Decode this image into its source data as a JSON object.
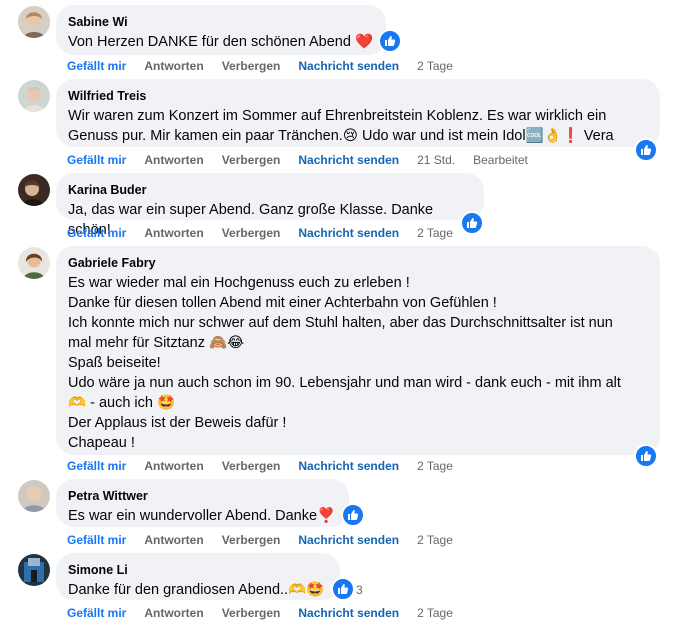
{
  "actions": {
    "like": "Gefällt mir",
    "reply": "Antworten",
    "hide": "Verbergen",
    "message": "Nachricht senden"
  },
  "colors": {
    "link": "#1877f2",
    "bubble": "#f0f2f5",
    "meta": "#65676b"
  },
  "comments": [
    {
      "author": "Sabine Wi",
      "text": "Von Herzen DANKE für den schönen Abend ❤️",
      "time": "2 Tage",
      "avatar_icon": "profile-photo",
      "reaction_icon": "like-reaction-icon"
    },
    {
      "author": "Wilfried Treis",
      "text": "Wir waren zum Konzert im Sommer auf Ehrenbreitstein Koblenz. Es war wirklich ein\nGenuss pur. Mir kamen ein paar Tränchen.😢 Udo war und ist mein Idol🆒👌❗ Vera",
      "time": "21 Std.",
      "edited": "Bearbeitet",
      "avatar_icon": "profile-photo",
      "reaction_icon": "like-reaction-icon"
    },
    {
      "author": "Karina Buder",
      "text": "Ja, das war ein super Abend. Ganz große Klasse. Danke schön!",
      "time": "2 Tage",
      "avatar_icon": "profile-photo",
      "reaction_icon": "like-reaction-icon"
    },
    {
      "author": "Gabriele Fabry",
      "text": "Es war wieder mal ein Hochgenuss euch zu erleben !\nDanke für diesen tollen Abend mit einer Achterbahn von Gefühlen !\nIch konnte mich nur schwer auf dem Stuhl halten, aber das Durchschnittsalter ist nun\nmal mehr für Sitztanz 🙈😂\nSpaß beiseite!\nUdo wäre ja nun auch schon im 90. Lebensjahr und man wird - dank euch - mit ihm alt\n🫶 - auch ich 🤩\nDer Applaus ist der Beweis dafür !\nChapeau !",
      "time": "2 Tage",
      "avatar_icon": "profile-photo",
      "reaction_icon": "like-reaction-icon"
    },
    {
      "author": "Petra Wittwer",
      "text": "Es war ein wundervoller Abend. Danke❣️",
      "time": "2 Tage",
      "avatar_icon": "profile-photo",
      "reaction_icon": "like-reaction-icon"
    },
    {
      "author": "Simone Li",
      "text": "Danke für den grandiosen Abend..🫶🤩",
      "time": "2 Tage",
      "reaction_count": "3",
      "avatar_icon": "profile-photo",
      "reaction_icon": "like-reaction-icon"
    }
  ]
}
